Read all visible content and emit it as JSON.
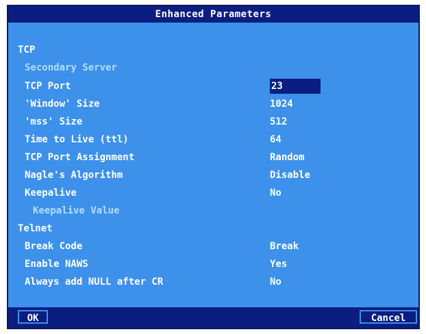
{
  "title": "Enhanced Parameters",
  "rows": [
    {
      "label": "TCP",
      "value": ""
    },
    {
      "label": "Secondary Server",
      "value": ""
    },
    {
      "label": "TCP Port",
      "value": "23"
    },
    {
      "label": "'Window' Size",
      "value": "1024"
    },
    {
      "label": "'mss' Size",
      "value": "512"
    },
    {
      "label": "Time to Live (ttl)",
      "value": "64"
    },
    {
      "label": "TCP Port Assignment",
      "value": "Random"
    },
    {
      "label": "Nagle's Algorithm",
      "value": "Disable"
    },
    {
      "label": "Keepalive",
      "value": "No"
    },
    {
      "label": "Keepalive Value",
      "value": ""
    },
    {
      "label": "Telnet",
      "value": ""
    },
    {
      "label": "Break Code",
      "value": "Break"
    },
    {
      "label": "Enable NAWS",
      "value": "Yes"
    },
    {
      "label": "Always add NULL after CR",
      "value": "No"
    }
  ],
  "buttons": {
    "ok": "OK",
    "cancel": "Cancel"
  },
  "colors": {
    "window_bg": "#3d91ea",
    "bar_bg": "#0b1d80",
    "text": "#ffffff",
    "disabled_text": "#b4dcff"
  }
}
